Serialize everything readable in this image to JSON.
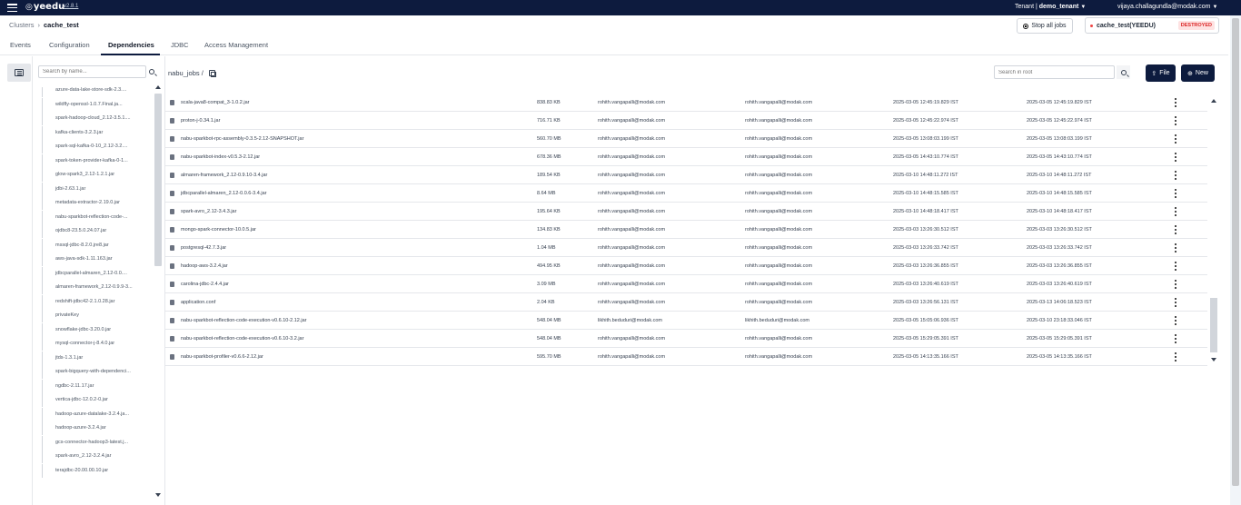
{
  "app": {
    "brand": "yeedu",
    "version": "v2.8.1"
  },
  "topbar": {
    "tenant_label": "Tenant",
    "tenant_name": "demo_tenant",
    "user": "vijaya.challagundla@modak.com"
  },
  "breadcrumb": {
    "parent": "Clusters",
    "current": "cache_test"
  },
  "actions": {
    "stop_all": "Stop all jobs"
  },
  "cluster": {
    "name": "cache_test(YEEDU)",
    "status": "DESTROYED",
    "status_color": "#dc2626"
  },
  "tabs": [
    "Events",
    "Configuration",
    "Dependencies",
    "JDBC",
    "Access Management"
  ],
  "active_tab": "Dependencies",
  "sidebar": {
    "search_placeholder": "Search by name...",
    "items": [
      "azure-data-lake-store-sdk-2.3....",
      "wildfly-openssl-1.0.7.Final.ja...",
      "spark-hadoop-cloud_2.12-3.5.1....",
      "kafka-clients-3.2.3.jar",
      "spark-sql-kafka-0-10_2.12-3.2....",
      "spark-token-provider-kafka-0-1...",
      "glow-spark3_2.12-1.2.1.jar",
      "jdbi-2.63.1.jar",
      "metadata-extractor-2.19.0.jar",
      "nabu-sparkbot-reflection-code-...",
      "ojdbc8-23.5.0.24.07.jar",
      "mssql-jdbc-8.2.0.jre8.jar",
      "aws-java-sdk-1.11.163.jar",
      "jdbcparallel-almaren_2.12-0.0....",
      "almaren-framework_2.12-0.9.9-3...",
      "redshift-jdbc42-2.1.0.28.jar",
      "privateKey",
      "snowflake-jdbc-3.20.0.jar",
      "mysql-connector-j-8.4.0.jar",
      "jtds-1.3.1.jar",
      "spark-bigquery-with-dependenci...",
      "ngdbc-2.11.17.jar",
      "vertica-jdbc-12.0.2-0.jar",
      "hadoop-azure-datalake-3.2.4.ja...",
      "hadoop-azure-3.2.4.jar",
      "gcs-connector-hadoop3-latest.j...",
      "spark-avro_2.12-3.2.4.jar",
      "terajdbc-20.00.00.10.jar"
    ]
  },
  "main": {
    "path": "nabu_jobs /",
    "search_placeholder": "Search in root",
    "file_button": "File",
    "new_button": "New",
    "rows": [
      {
        "name": "scala-java8-compat_3-1.0.2.jar",
        "size": "838.83 KB",
        "owner": "rohith.vangapalli@modak.com",
        "modified_by": "rohith.vangapalli@modak.com",
        "created": "2025-03-05 12:45:19.829 IST",
        "updated": "2025-03-05 12:45:19.829 IST"
      },
      {
        "name": "proton-j-0.34.1.jar",
        "size": "716.71 KB",
        "owner": "rohith.vangapalli@modak.com",
        "modified_by": "rohith.vangapalli@modak.com",
        "created": "2025-03-05 12:45:22.974 IST",
        "updated": "2025-03-05 12:45:22.974 IST"
      },
      {
        "name": "nabu-sparkbot-rpc-assembly-0.3.5-2.12-SNAPSHOT.jar",
        "size": "560.70 MB",
        "owner": "rohith.vangapalli@modak.com",
        "modified_by": "rohith.vangapalli@modak.com",
        "created": "2025-03-05 13:08:03.199 IST",
        "updated": "2025-03-05 13:08:03.199 IST"
      },
      {
        "name": "nabu-sparkbot-index-v0.5.3-2.12.jar",
        "size": "678.36 MB",
        "owner": "rohith.vangapalli@modak.com",
        "modified_by": "rohith.vangapalli@modak.com",
        "created": "2025-03-05 14:43:10.774 IST",
        "updated": "2025-03-05 14:43:10.774 IST"
      },
      {
        "name": "almaren-framework_2.12-0.9.10-3.4.jar",
        "size": "189.54 KB",
        "owner": "rohith.vangapalli@modak.com",
        "modified_by": "rohith.vangapalli@modak.com",
        "created": "2025-03-10 14:48:11.272 IST",
        "updated": "2025-03-10 14:48:11.272 IST"
      },
      {
        "name": "jdbcparallel-almaren_2.12-0.0.6-3.4.jar",
        "size": "8.64 MB",
        "owner": "rohith.vangapalli@modak.com",
        "modified_by": "rohith.vangapalli@modak.com",
        "created": "2025-03-10 14:48:15.585 IST",
        "updated": "2025-03-10 14:48:15.585 IST"
      },
      {
        "name": "spark-avro_2.12-3.4.3.jar",
        "size": "195.64 KB",
        "owner": "rohith.vangapalli@modak.com",
        "modified_by": "rohith.vangapalli@modak.com",
        "created": "2025-03-10 14:48:18.417 IST",
        "updated": "2025-03-10 14:48:18.417 IST"
      },
      {
        "name": "mongo-spark-connector-10.0.5.jar",
        "size": "134.83 KB",
        "owner": "rohith.vangapalli@modak.com",
        "modified_by": "rohith.vangapalli@modak.com",
        "created": "2025-03-03 13:26:30.512 IST",
        "updated": "2025-03-03 13:26:30.512 IST"
      },
      {
        "name": "postgresql-42.7.3.jar",
        "size": "1.04 MB",
        "owner": "rohith.vangapalli@modak.com",
        "modified_by": "rohith.vangapalli@modak.com",
        "created": "2025-03-03 13:26:33.742 IST",
        "updated": "2025-03-03 13:26:33.742 IST"
      },
      {
        "name": "hadoop-aws-3.2.4.jar",
        "size": "494.95 KB",
        "owner": "rohith.vangapalli@modak.com",
        "modified_by": "rohith.vangapalli@modak.com",
        "created": "2025-03-03 13:26:36.855 IST",
        "updated": "2025-03-03 13:26:36.855 IST"
      },
      {
        "name": "carolina-jdbc-2.4.4.jar",
        "size": "3.09 MB",
        "owner": "rohith.vangapalli@modak.com",
        "modified_by": "rohith.vangapalli@modak.com",
        "created": "2025-03-03 13:26:40.619 IST",
        "updated": "2025-03-03 13:26:40.619 IST"
      },
      {
        "name": "application.conf",
        "size": "2.04 KB",
        "owner": "rohith.vangapalli@modak.com",
        "modified_by": "rohith.vangapalli@modak.com",
        "created": "2025-03-03 13:26:56.131 IST",
        "updated": "2025-03-13 14:06:18.523 IST"
      },
      {
        "name": "nabu-sparkbot-reflection-code-execution-v0.6.10-2.12.jar",
        "size": "548.04 MB",
        "owner": "likhith.beduduri@modak.com",
        "modified_by": "likhith.beduduri@modak.com",
        "created": "2025-03-05 15:05:06.936 IST",
        "updated": "2025-03-10 23:18:33.046 IST"
      },
      {
        "name": "nabu-sparkbot-reflection-code-execution-v0.6.10-3.2.jar",
        "size": "548.04 MB",
        "owner": "rohith.vangapalli@modak.com",
        "modified_by": "rohith.vangapalli@modak.com",
        "created": "2025-03-05 15:29:05.391 IST",
        "updated": "2025-03-05 15:29:05.391 IST"
      },
      {
        "name": "nabu-sparkbot-profiler-v0.6.6-2.12.jar",
        "size": "595.70 MB",
        "owner": "rohith.vangapalli@modak.com",
        "modified_by": "rohith.vangapalli@modak.com",
        "created": "2025-03-05 14:13:35.166 IST",
        "updated": "2025-03-05 14:13:35.166 IST"
      }
    ]
  }
}
